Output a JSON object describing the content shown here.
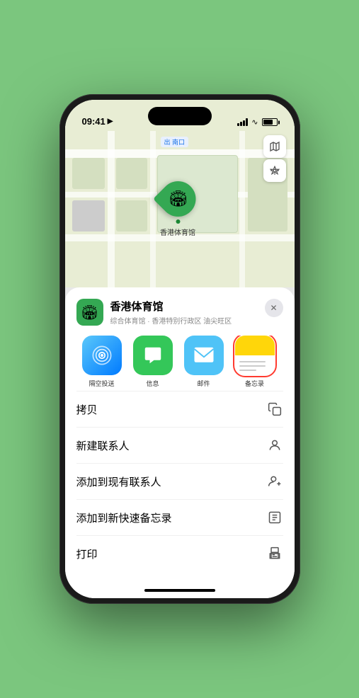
{
  "phone": {
    "status_bar": {
      "time": "09:41",
      "location_arrow": "▶"
    },
    "map": {
      "label_text": "南口",
      "label_prefix": "出",
      "stadium_name": "香港体育馆",
      "marker_emoji": "🏟"
    },
    "venue_card": {
      "name": "香港体育馆",
      "subtitle": "综合体育馆 · 香港特别行政区 油尖旺区",
      "close_label": "✕"
    },
    "share_items": [
      {
        "id": "airdrop",
        "label": "隔空投送",
        "icon_class": "icon-airdrop",
        "emoji": "📡"
      },
      {
        "id": "message",
        "label": "信息",
        "icon_class": "icon-message",
        "emoji": "💬"
      },
      {
        "id": "mail",
        "label": "邮件",
        "icon_class": "icon-mail",
        "emoji": "✉️"
      },
      {
        "id": "notes",
        "label": "备忘录",
        "icon_class": "icon-notes",
        "selected": true
      }
    ],
    "action_items": [
      {
        "id": "copy",
        "label": "拷贝",
        "icon": "⎘"
      },
      {
        "id": "new-contact",
        "label": "新建联系人",
        "icon": "👤"
      },
      {
        "id": "add-contact",
        "label": "添加到现有联系人",
        "icon": "👤"
      },
      {
        "id": "quick-note",
        "label": "添加到新快速备忘录",
        "icon": "📋"
      },
      {
        "id": "print",
        "label": "打印",
        "icon": "🖨"
      }
    ]
  }
}
